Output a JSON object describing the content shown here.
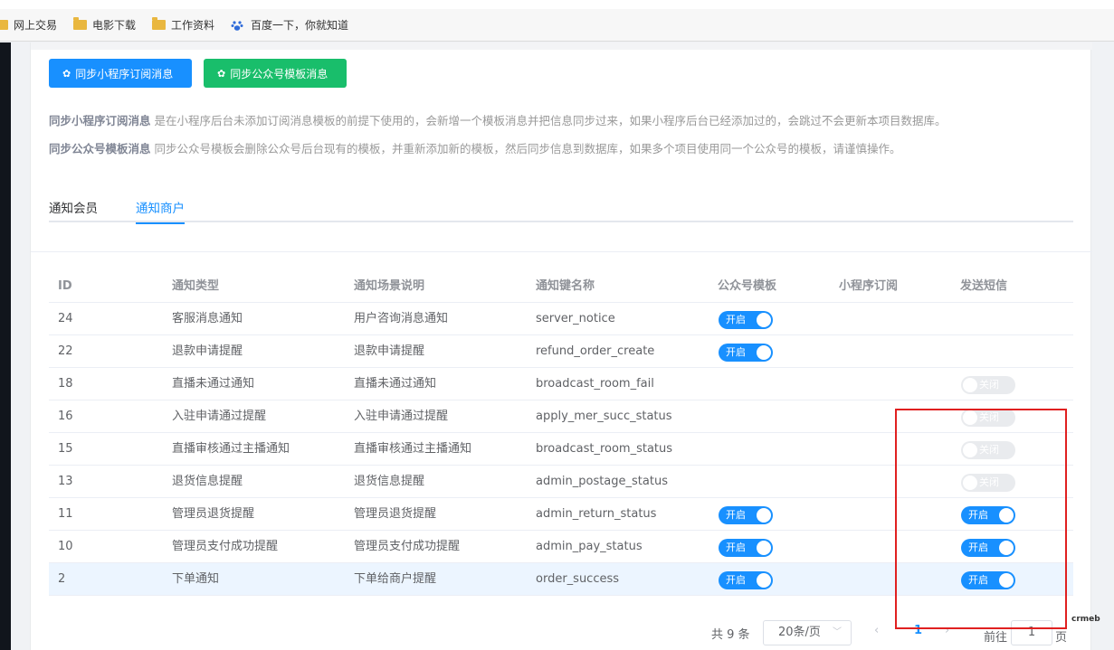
{
  "browser": {
    "bookmarks": [
      "网上交易",
      "电影下载",
      "工作资料",
      "百度一下，你就知道"
    ]
  },
  "toolbar": {
    "sync_mini": "同步小程序订阅消息",
    "sync_mp": "同步公众号模板消息"
  },
  "descriptions": {
    "mini_title": "同步小程序订阅消息",
    "mini_text": " 是在小程序后台未添加订阅消息模板的前提下使用的，会新增一个模板消息并把信息同步过来，如果小程序后台已经添加过的，会跳过不会更新本项目数据库。",
    "mp_title": "同步公众号模板消息",
    "mp_text": " 同步公众号模板会删除公众号后台现有的模板，并重新添加新的模板，然后同步信息到数据库，如果多个项目使用同一个公众号的模板，请谨慎操作。"
  },
  "tabs": [
    {
      "label": "通知会员",
      "active": false
    },
    {
      "label": "通知商户",
      "active": true
    }
  ],
  "table": {
    "headers": [
      "ID",
      "通知类型",
      "通知场景说明",
      "通知键名称",
      "公众号模板",
      "小程序订阅",
      "发送短信"
    ],
    "switch_on_label": "开启",
    "switch_off_label": "关闭",
    "rows": [
      {
        "id": "24",
        "type": "客服消息通知",
        "scene": "用户咨询消息通知",
        "key": "server_notice",
        "mp": "on",
        "mini": null,
        "sms": null
      },
      {
        "id": "22",
        "type": "退款申请提醒",
        "scene": "退款申请提醒",
        "key": "refund_order_create",
        "mp": "on",
        "mini": null,
        "sms": null
      },
      {
        "id": "18",
        "type": "直播未通过通知",
        "scene": "直播未通过通知",
        "key": "broadcast_room_fail",
        "mp": null,
        "mini": null,
        "sms": "off"
      },
      {
        "id": "16",
        "type": "入驻申请通过提醒",
        "scene": "入驻申请通过提醒",
        "key": "apply_mer_succ_status",
        "mp": null,
        "mini": null,
        "sms": "off"
      },
      {
        "id": "15",
        "type": "直播审核通过主播通知",
        "scene": "直播审核通过主播通知",
        "key": "broadcast_room_status",
        "mp": null,
        "mini": null,
        "sms": "off"
      },
      {
        "id": "13",
        "type": "退货信息提醒",
        "scene": "退货信息提醒",
        "key": "admin_postage_status",
        "mp": null,
        "mini": null,
        "sms": "off"
      },
      {
        "id": "11",
        "type": "管理员退货提醒",
        "scene": "管理员退货提醒",
        "key": "admin_return_status",
        "mp": "on",
        "mini": null,
        "sms": "on"
      },
      {
        "id": "10",
        "type": "管理员支付成功提醒",
        "scene": "管理员支付成功提醒",
        "key": "admin_pay_status",
        "mp": "on",
        "mini": null,
        "sms": "on"
      },
      {
        "id": "2",
        "type": "下单通知",
        "scene": "下单给商户提醒",
        "key": "order_success",
        "mp": "on",
        "mini": null,
        "sms": "on",
        "highlight": true
      }
    ]
  },
  "pagination": {
    "total": "共 9 条",
    "page_size": "20条/页",
    "current": "1",
    "goto_prefix": "前往",
    "goto_value": "1",
    "goto_suffix": "页"
  },
  "watermark": "crmeb",
  "colors": {
    "primary": "#1890ff",
    "success": "#19be6b",
    "annotation": "#e02020"
  }
}
